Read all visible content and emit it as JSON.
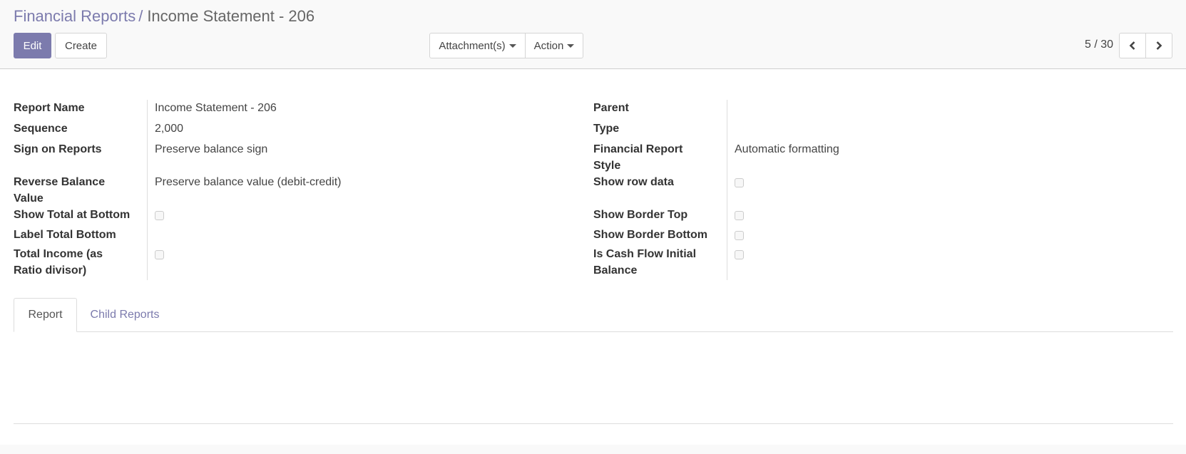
{
  "breadcrumb": {
    "parent": "Financial Reports",
    "separator": "/",
    "current": "Income Statement - 206"
  },
  "toolbar": {
    "edit_label": "Edit",
    "create_label": "Create",
    "attachments_label": "Attachment(s)",
    "action_label": "Action"
  },
  "pager": {
    "value": "5 / 30",
    "prev_icon": "chevron-left-icon",
    "next_icon": "chevron-right-icon"
  },
  "form": {
    "left": [
      {
        "label": "Report Name",
        "value": "Income Statement - 206",
        "kind": "text"
      },
      {
        "label": "Sequence",
        "value": "2,000",
        "kind": "text"
      },
      {
        "label": "Sign on Reports",
        "value": "Preserve balance sign",
        "kind": "text"
      },
      {
        "label": "Reverse Balance Value",
        "value": "Preserve balance value (debit-credit)",
        "kind": "text"
      },
      {
        "label": "Show Total at Bottom",
        "value": false,
        "kind": "checkbox"
      },
      {
        "label": "Label Total Bottom",
        "value": "",
        "kind": "text"
      },
      {
        "label": "Total Income (as Ratio divisor)",
        "value": false,
        "kind": "checkbox"
      }
    ],
    "right": [
      {
        "label": "Parent",
        "value": "",
        "kind": "text"
      },
      {
        "label": "Type",
        "value": "",
        "kind": "text"
      },
      {
        "label": "Financial Report Style",
        "value": "Automatic formatting",
        "kind": "text"
      },
      {
        "label": "Show row data",
        "value": false,
        "kind": "checkbox"
      },
      {
        "label": "Show Border Top",
        "value": false,
        "kind": "checkbox"
      },
      {
        "label": "Show Border Bottom",
        "value": false,
        "kind": "checkbox"
      },
      {
        "label": "Is Cash Flow Initial Balance",
        "value": false,
        "kind": "checkbox"
      }
    ]
  },
  "tabs": [
    {
      "label": "Report",
      "active": true
    },
    {
      "label": "Child Reports",
      "active": false
    }
  ],
  "colors": {
    "accent": "#7c7bad",
    "background": "#f9f9f9",
    "sheet": "#ffffff"
  }
}
